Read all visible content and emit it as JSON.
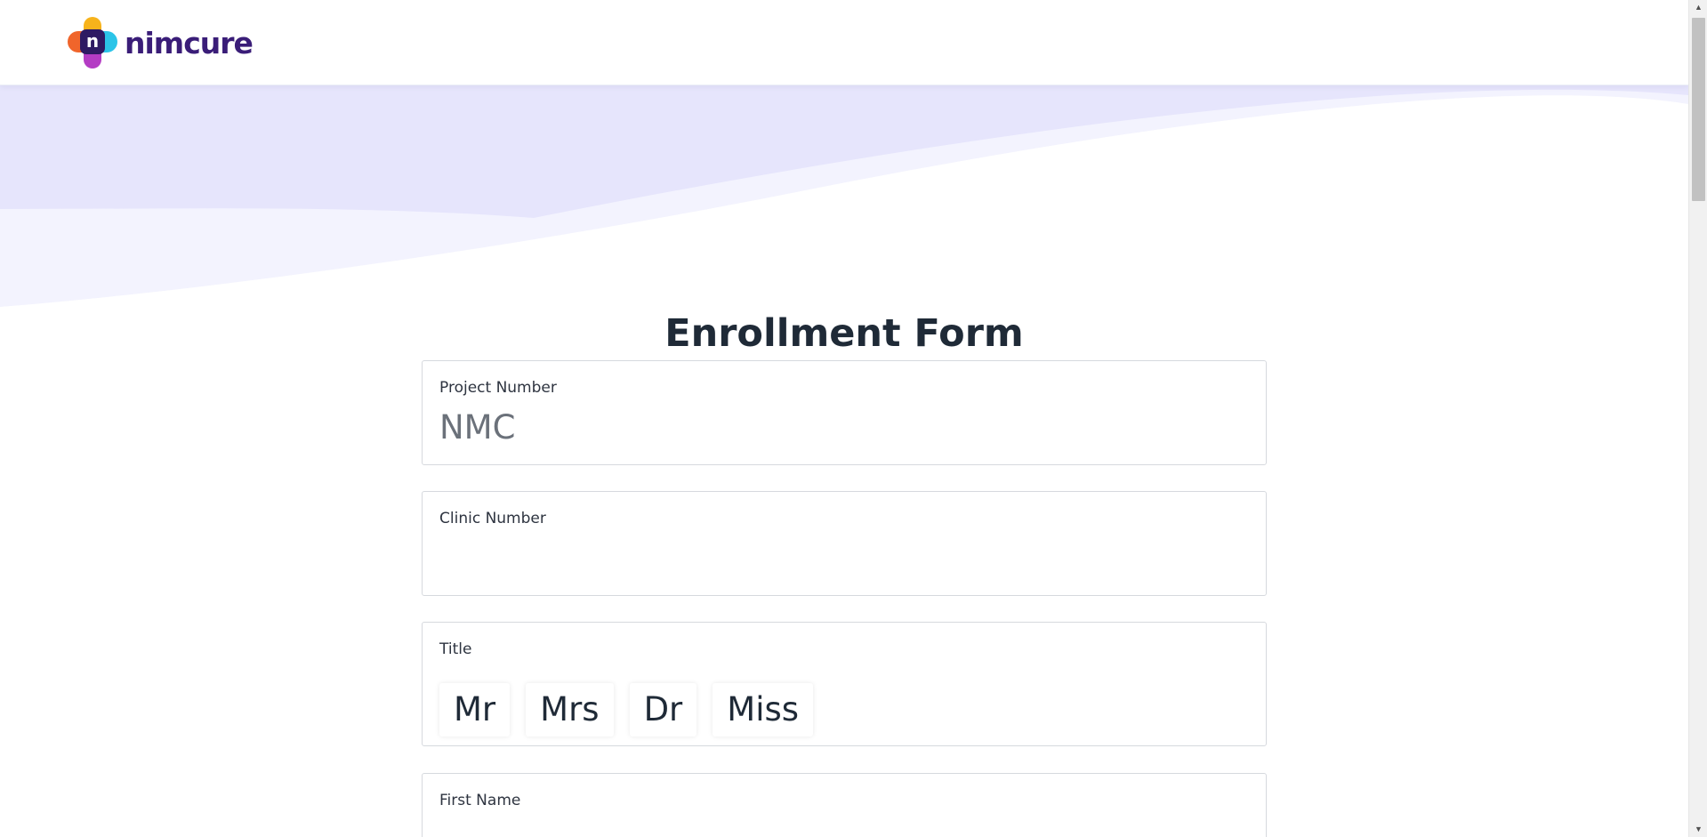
{
  "brand": {
    "logo_letter": "n",
    "name": "nimcure"
  },
  "form": {
    "title": "Enrollment Form",
    "project_number": {
      "label": "Project Number",
      "placeholder": "NMC",
      "value": ""
    },
    "clinic_number": {
      "label": "Clinic Number",
      "placeholder": "",
      "value": ""
    },
    "title_field": {
      "label": "Title",
      "options": [
        "Mr",
        "Mrs",
        "Dr",
        "Miss"
      ]
    },
    "first_name": {
      "label": "First Name"
    }
  },
  "colors": {
    "brand_purple": "#3a1d78",
    "wave_dark": "#e6e5fc",
    "wave_light": "#f3f3fe"
  },
  "icons": {
    "scroll_up": "scroll-up-arrow-icon",
    "scroll_down": "scroll-down-arrow-icon"
  }
}
